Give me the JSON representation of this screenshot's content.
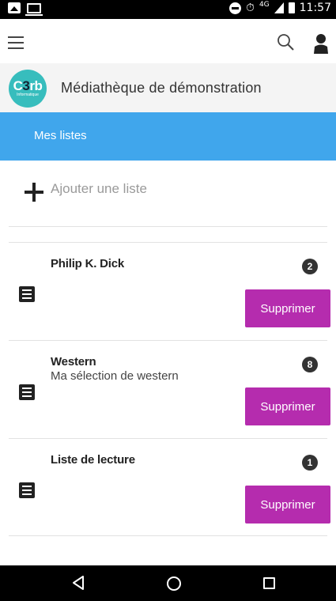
{
  "status_bar": {
    "time": "11:57",
    "network": "4G",
    "icons": [
      "image-icon",
      "screen-cast-icon",
      "do-not-disturb-icon",
      "alarm-icon",
      "signal-icon",
      "battery-icon"
    ]
  },
  "top_bar": {
    "icons": [
      "menu-icon",
      "search-icon",
      "user-icon"
    ]
  },
  "library": {
    "logo_text_main_prefix": "C",
    "logo_text_main_digit": "3",
    "logo_text_main_suffix": "rb",
    "logo_text_sub": "Informatique",
    "name": "Médiathèque de démonstration"
  },
  "tab": {
    "label": "Mes listes",
    "color": "#40a6ec"
  },
  "add_list": {
    "label": "Ajouter une liste"
  },
  "lists": [
    {
      "title": "Philip K. Dick",
      "description": "",
      "count": "2",
      "delete_label": "Supprimer"
    },
    {
      "title": "Western",
      "description": "Ma sélection de western",
      "count": "8",
      "delete_label": "Supprimer"
    },
    {
      "title": "Liste de lecture",
      "description": "",
      "count": "1",
      "delete_label": "Supprimer"
    }
  ],
  "colors": {
    "delete_button": "#b52cae",
    "logo": "#37bdbd"
  },
  "nav_bar": {
    "icons": [
      "back-icon",
      "home-icon",
      "recents-icon"
    ]
  }
}
